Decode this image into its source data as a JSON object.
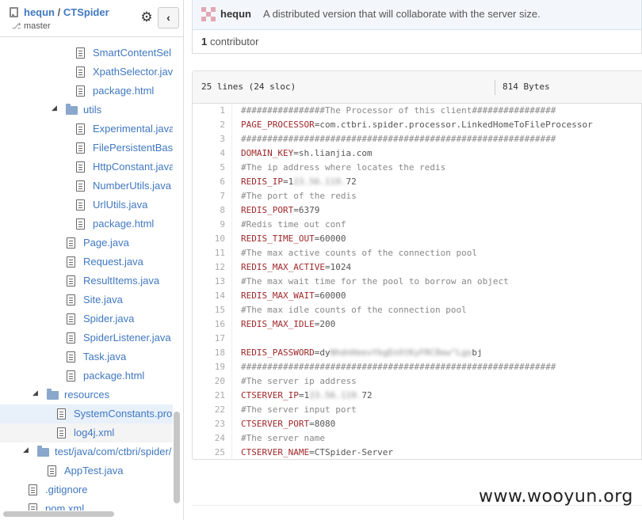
{
  "repo": {
    "owner": "hequn",
    "separator": "/",
    "name": "CTSpider",
    "branch": "master"
  },
  "tree": [
    {
      "label": "SmartContentSel",
      "kind": "file",
      "indent": 117
    },
    {
      "label": "XpathSelector.java",
      "kind": "file",
      "indent": 117
    },
    {
      "label": "package.html",
      "kind": "file",
      "indent": 117
    },
    {
      "label": "utils",
      "kind": "folder",
      "indent": 105,
      "expanded": true
    },
    {
      "label": "Experimental.java",
      "kind": "file",
      "indent": 117
    },
    {
      "label": "FilePersistentBas",
      "kind": "file",
      "indent": 117
    },
    {
      "label": "HttpConstant.java",
      "kind": "file",
      "indent": 117
    },
    {
      "label": "NumberUtils.java",
      "kind": "file",
      "indent": 117
    },
    {
      "label": "UrlUtils.java",
      "kind": "file",
      "indent": 117
    },
    {
      "label": "package.html",
      "kind": "file",
      "indent": 117
    },
    {
      "label": "Page.java",
      "kind": "file",
      "indent": 105
    },
    {
      "label": "Request.java",
      "kind": "file",
      "indent": 105
    },
    {
      "label": "ResultItems.java",
      "kind": "file",
      "indent": 105
    },
    {
      "label": "Site.java",
      "kind": "file",
      "indent": 105
    },
    {
      "label": "Spider.java",
      "kind": "file",
      "indent": 105
    },
    {
      "label": "SpiderListener.java",
      "kind": "file",
      "indent": 105
    },
    {
      "label": "Task.java",
      "kind": "file",
      "indent": 105
    },
    {
      "label": "package.html",
      "kind": "file",
      "indent": 105
    },
    {
      "label": "resources",
      "kind": "folder",
      "indent": 81,
      "expanded": true
    },
    {
      "label": "SystemConstants.pro",
      "kind": "file",
      "indent": 93,
      "selected": true
    },
    {
      "label": "log4j.xml",
      "kind": "file",
      "indent": 93,
      "hover": true
    },
    {
      "label": "test/java/com/ctbri/spider/",
      "kind": "folder",
      "indent": 69,
      "expanded": true
    },
    {
      "label": "AppTest.java",
      "kind": "file",
      "indent": 81
    },
    {
      "label": ".gitignore",
      "kind": "file",
      "indent": 57
    },
    {
      "label": "pom.xml",
      "kind": "file",
      "indent": 57
    }
  ],
  "commit": {
    "author": "hequn",
    "message": "A distributed version that will collaborate with the server size."
  },
  "contributors": {
    "count": "1",
    "label": "contributor"
  },
  "file": {
    "lines_info": "25 lines (24 sloc)",
    "size": "814 Bytes"
  },
  "code": [
    {
      "n": "1",
      "parts": [
        {
          "t": "################The Processor of this client################",
          "c": "c"
        }
      ]
    },
    {
      "n": "2",
      "parts": [
        {
          "t": "PAGE_PROCESSOR",
          "c": "k"
        },
        {
          "t": "=com.ctbri.spider.processor.LinkedHomeToFileProcessor",
          "c": ""
        }
      ]
    },
    {
      "n": "3",
      "parts": [
        {
          "t": "############################################################",
          "c": "c"
        }
      ]
    },
    {
      "n": "4",
      "parts": [
        {
          "t": "DOMAIN_KEY",
          "c": "k"
        },
        {
          "t": "=sh.lianjia.com",
          "c": ""
        }
      ]
    },
    {
      "n": "5",
      "parts": [
        {
          "t": "#The ip address where locates the redis",
          "c": "c"
        }
      ]
    },
    {
      "n": "6",
      "parts": [
        {
          "t": "REDIS_IP",
          "c": "k"
        },
        {
          "t": "=1",
          "c": ""
        },
        {
          "t": "23.56.119.",
          "c": "blur"
        },
        {
          "t": "72",
          "c": ""
        }
      ]
    },
    {
      "n": "7",
      "parts": [
        {
          "t": "#The port of the redis",
          "c": "c"
        }
      ]
    },
    {
      "n": "8",
      "parts": [
        {
          "t": "REDIS_PORT",
          "c": "k"
        },
        {
          "t": "=6379",
          "c": ""
        }
      ]
    },
    {
      "n": "9",
      "parts": [
        {
          "t": "#Redis time out conf",
          "c": "c"
        }
      ]
    },
    {
      "n": "10",
      "parts": [
        {
          "t": "REDIS_TIME_OUT",
          "c": "k"
        },
        {
          "t": "=60000",
          "c": ""
        }
      ]
    },
    {
      "n": "11",
      "parts": [
        {
          "t": "#The max active counts of the connection pool",
          "c": "c"
        }
      ]
    },
    {
      "n": "12",
      "parts": [
        {
          "t": "REDIS_MAX_ACTIVE",
          "c": "k"
        },
        {
          "t": "=1024",
          "c": ""
        }
      ]
    },
    {
      "n": "13",
      "parts": [
        {
          "t": "#The max wait time for the pool to borrow an object",
          "c": "c"
        }
      ]
    },
    {
      "n": "14",
      "parts": [
        {
          "t": "REDIS_MAX_WAIT",
          "c": "k"
        },
        {
          "t": "=60000",
          "c": ""
        }
      ]
    },
    {
      "n": "15",
      "parts": [
        {
          "t": "#The max idle counts of the connection pool",
          "c": "c"
        }
      ]
    },
    {
      "n": "16",
      "parts": [
        {
          "t": "REDIS_MAX_IDLE",
          "c": "k"
        },
        {
          "t": "=200",
          "c": ""
        }
      ]
    },
    {
      "n": "17",
      "parts": []
    },
    {
      "n": "18",
      "parts": [
        {
          "t": "REDIS_PASSWORD",
          "c": "k"
        },
        {
          "t": "=dy",
          "c": ""
        },
        {
          "t": "NhdnHeevYkgEnXtKyFRC8ew^Lgo",
          "c": "blur"
        },
        {
          "t": "bj",
          "c": ""
        }
      ]
    },
    {
      "n": "19",
      "parts": [
        {
          "t": "############################################################",
          "c": "c"
        }
      ]
    },
    {
      "n": "20",
      "parts": [
        {
          "t": "#The server ip address",
          "c": "c"
        }
      ]
    },
    {
      "n": "21",
      "parts": [
        {
          "t": "CTSERVER_IP",
          "c": "k"
        },
        {
          "t": "=1",
          "c": ""
        },
        {
          "t": "23.56.119.",
          "c": "blur"
        },
        {
          "t": "72",
          "c": ""
        }
      ]
    },
    {
      "n": "22",
      "parts": [
        {
          "t": "#The server input port",
          "c": "c"
        }
      ]
    },
    {
      "n": "23",
      "parts": [
        {
          "t": "CTSERVER_PORT",
          "c": "k"
        },
        {
          "t": "=8080",
          "c": ""
        }
      ]
    },
    {
      "n": "24",
      "parts": [
        {
          "t": "#The server name",
          "c": "c"
        }
      ]
    },
    {
      "n": "25",
      "parts": [
        {
          "t": "CTSERVER_NAME",
          "c": "k"
        },
        {
          "t": "=CTSpider-Server",
          "c": ""
        }
      ]
    }
  ],
  "watermark": "www.wooyun.org",
  "icons": {
    "gear": "gear-icon",
    "collapse": "chevron-left-icon",
    "repo": "repo-icon",
    "branch": "branch-icon"
  }
}
